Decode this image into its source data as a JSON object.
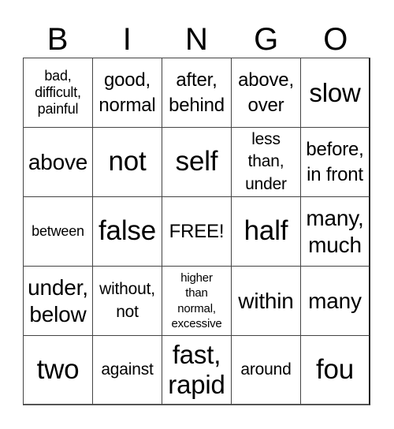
{
  "header": {
    "letters": [
      "B",
      "I",
      "N",
      "G",
      "O"
    ]
  },
  "cells": [
    "bad,\ndifficult,\npainful",
    "good,\nnormal",
    "after,\nbehind",
    "above,\nover",
    "slow",
    "above",
    "not",
    "self",
    "less\nthan,\nunder",
    "before,\nin front",
    "between",
    "false",
    "FREE!",
    "half",
    "many,\nmuch",
    "under,\nbelow",
    "without,\nnot",
    "higher\nthan\nnormal,\nexcessive",
    "within",
    "many",
    "two",
    "against",
    "fast,\nrapid",
    "around",
    "fou"
  ]
}
